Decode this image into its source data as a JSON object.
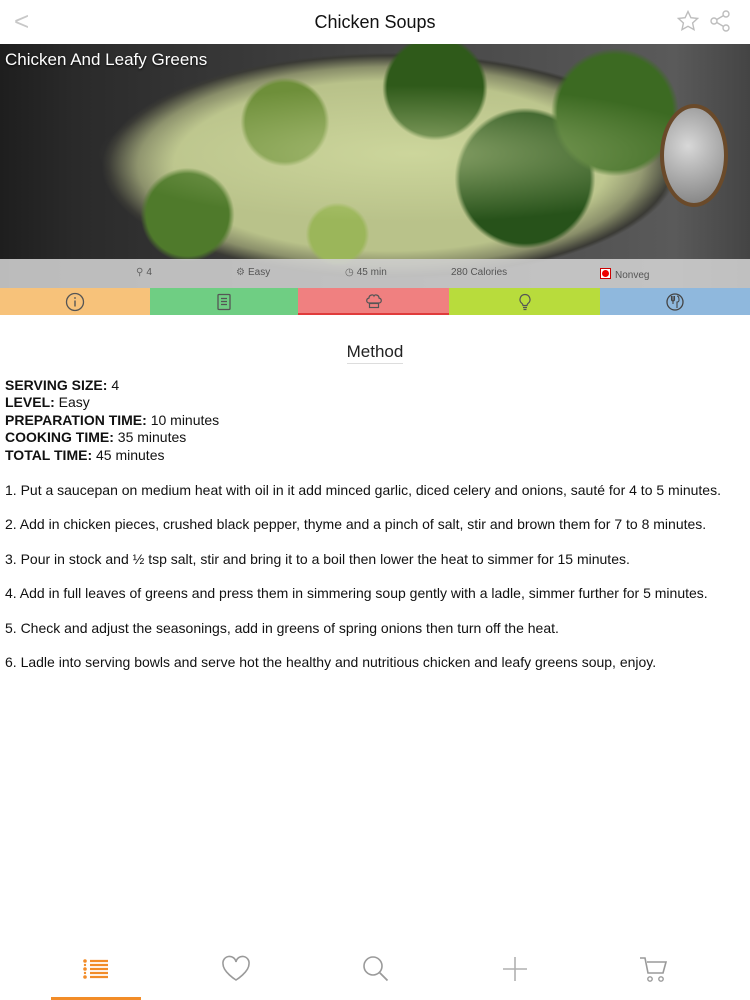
{
  "navbar": {
    "back_glyph": "<",
    "title": "Chicken Soups",
    "icons": [
      "star-icon",
      "share-icon"
    ]
  },
  "hero": {
    "recipe_title": "Chicken And Leafy Greens"
  },
  "info_strip": {
    "servings": "4",
    "level": "Easy",
    "time": "45 min",
    "calories": "280 Calories",
    "diet": "Nonveg"
  },
  "tabs": [
    {
      "name": "info",
      "icon": "info-icon",
      "color": "#f7c27a"
    },
    {
      "name": "ingredients",
      "icon": "list-icon",
      "color": "#6fce83"
    },
    {
      "name": "method",
      "icon": "chef-hat-icon",
      "color": "#f08080",
      "active": true
    },
    {
      "name": "tips",
      "icon": "lightbulb-icon",
      "color": "#b8dc3c"
    },
    {
      "name": "nutrition",
      "icon": "nutrition-icon",
      "color": "#8fb8dd"
    }
  ],
  "method": {
    "heading": "Method",
    "serving_size_label": "SERVING SIZE:",
    "serving_size": " 4",
    "level_label": "LEVEL:",
    "level": " Easy",
    "prep_label": "PREPARATION TIME:",
    "prep": " 10 minutes",
    "cook_label": "COOKING TIME:",
    "cook": " 35 minutes",
    "total_label": "TOTAL TIME:",
    "total": " 45 minutes",
    "steps": [
      "1. Put a saucepan on medium heat with oil in it add minced garlic, diced celery and onions, sauté for 4 to 5 minutes.",
      "2. Add in chicken pieces, crushed black pepper, thyme and a pinch of salt, stir and brown them for 7 to 8 minutes.",
      "3. Pour in stock and ½ tsp salt, stir and bring it to a boil then lower the heat to simmer for 15 minutes.",
      "4. Add in full leaves of greens and press them in simmering soup gently with a ladle, simmer further for 5 minutes.",
      "5. Check and adjust the seasonings, add in greens of spring onions then turn off the heat.",
      "6. Ladle into serving bowls and serve hot the healthy and nutritious chicken and leafy greens soup, enjoy."
    ]
  },
  "tabbar": {
    "items": [
      "list-icon",
      "heart-icon",
      "search-icon",
      "plus-icon",
      "cart-icon"
    ],
    "accent_color": "#f28c28"
  }
}
